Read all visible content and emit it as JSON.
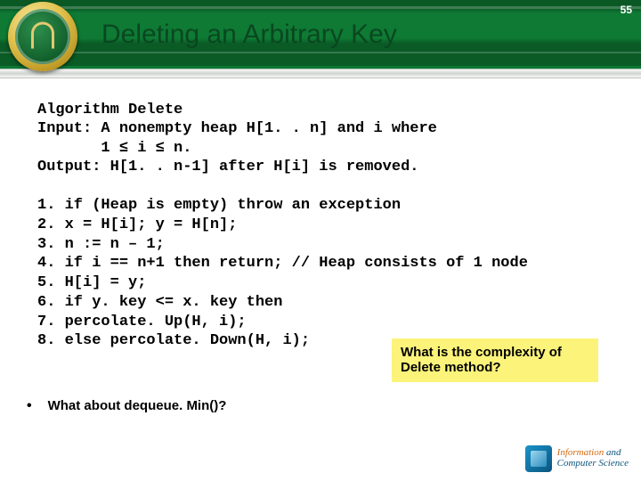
{
  "page_number": "55",
  "title": "Deleting an Arbitrary Key",
  "algo": {
    "name": "Algorithm Delete",
    "input_l1": "Input: A nonempty heap H[1. . n] and i where",
    "input_l2": "       1 ≤ i ≤ n.",
    "output": "Output: H[1. . n-1] after H[i] is removed."
  },
  "steps": {
    "s1": "1. if (Heap is empty) throw an exception",
    "s2": "2. x = H[i]; y = H[n];",
    "s3": "3. n := n – 1;",
    "s4": "4. if i == n+1 then return; // Heap consists of 1 node",
    "s5": "5. H[i] = y;",
    "s6": "6. if y. key <= x. key then",
    "s7": "7.  percolate. Up(H, i);",
    "s8": "8. else percolate. Down(H, i);"
  },
  "callout": {
    "line1": "What is the complexity of",
    "line2": "Delete method?"
  },
  "bullet": "What about dequeue. Min()?",
  "footer": {
    "line1a": "Information",
    "line1b": " and",
    "line2": "Computer Science"
  }
}
